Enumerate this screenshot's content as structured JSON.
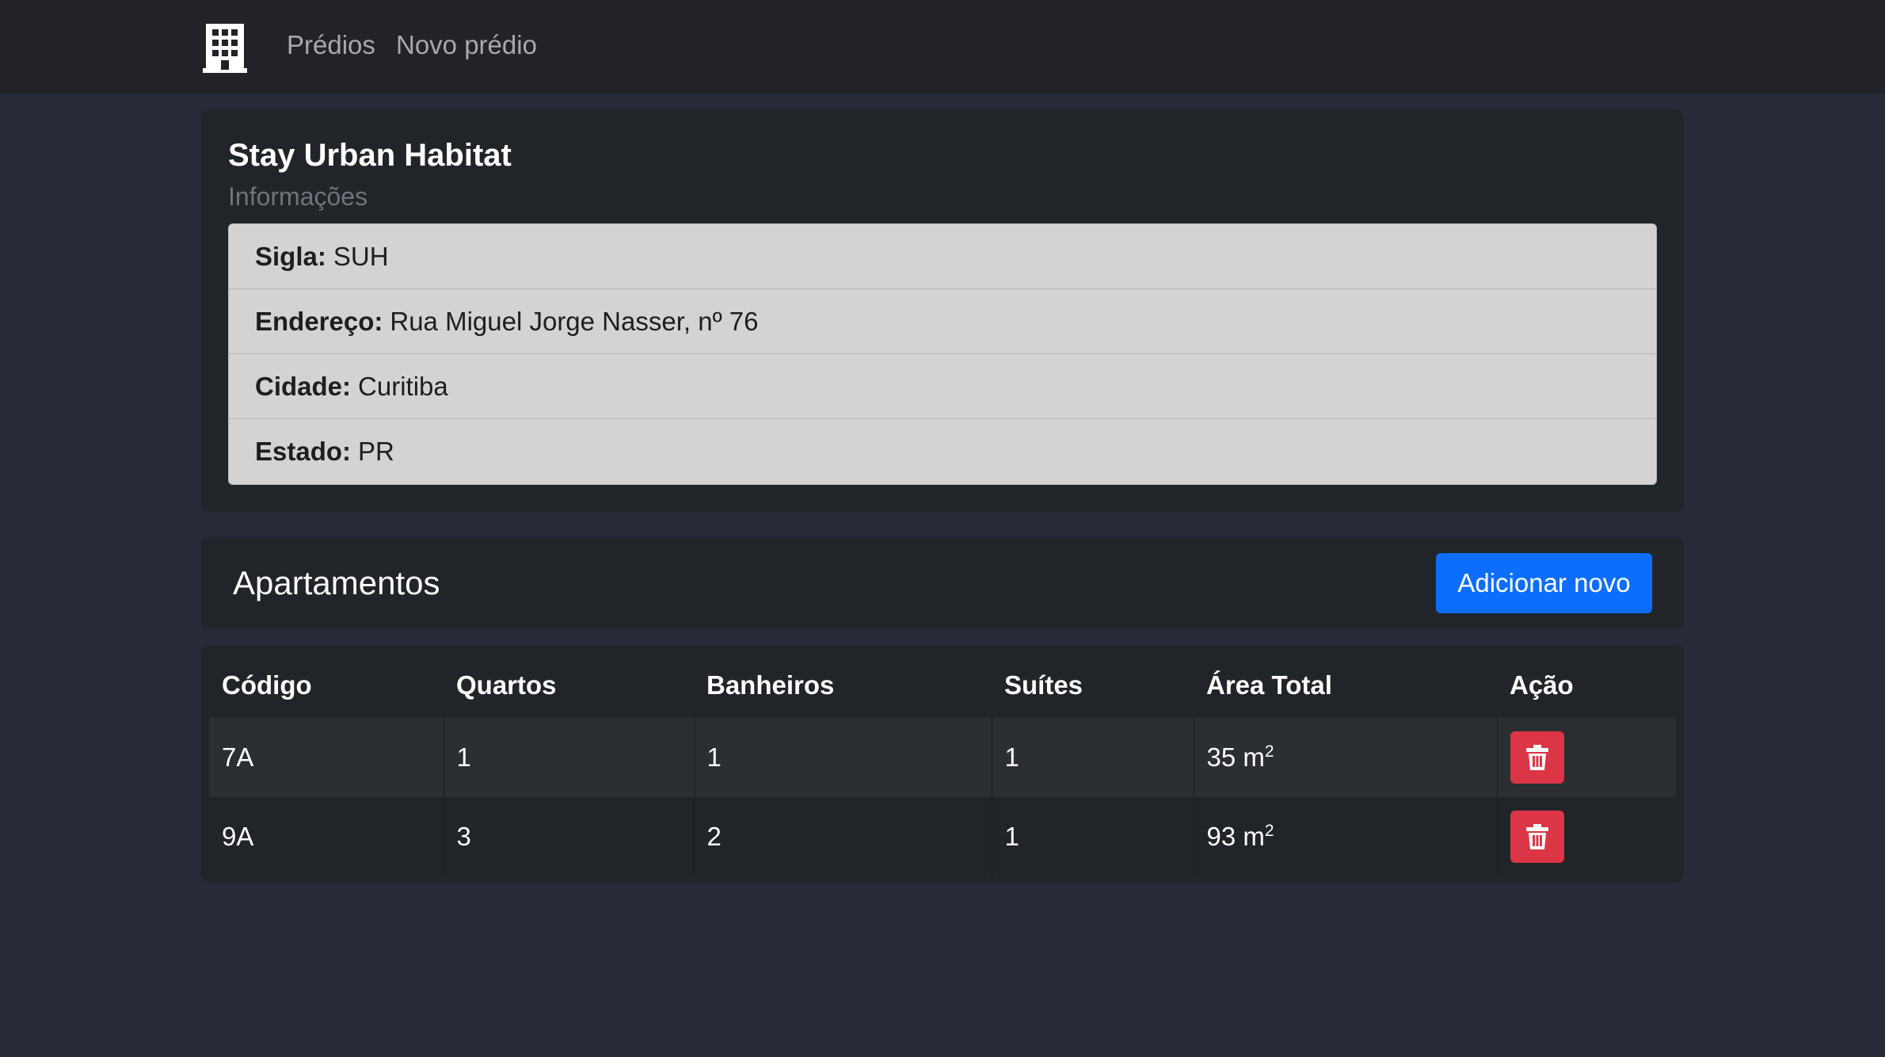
{
  "navbar": {
    "brand_icon": "building-icon",
    "links": [
      "Prédios",
      "Novo prédio"
    ]
  },
  "building": {
    "title": "Stay Urban Habitat",
    "subtitle": "Informações",
    "fields": [
      {
        "label": "Sigla:",
        "value": "SUH"
      },
      {
        "label": "Endereço:",
        "value": "Rua Miguel Jorge Nasser, nº 76"
      },
      {
        "label": "Cidade:",
        "value": "Curitiba"
      },
      {
        "label": "Estado:",
        "value": "PR"
      }
    ]
  },
  "apartments": {
    "title": "Apartamentos",
    "add_label": "Adicionar novo",
    "columns": [
      "Código",
      "Quartos",
      "Banheiros",
      "Suítes",
      "Área Total",
      "Ação"
    ],
    "area_unit": "m",
    "area_exponent": "2",
    "rows": [
      {
        "code": "7A",
        "rooms": "1",
        "bathrooms": "1",
        "suites": "1",
        "area": "35"
      },
      {
        "code": "9A",
        "rooms": "3",
        "bathrooms": "2",
        "suites": "1",
        "area": "93"
      }
    ],
    "action_icon": "trash-icon"
  },
  "colors": {
    "primary": "#0d6efd",
    "danger": "#dc3545",
    "background": "#272a37",
    "card": "#212429"
  }
}
